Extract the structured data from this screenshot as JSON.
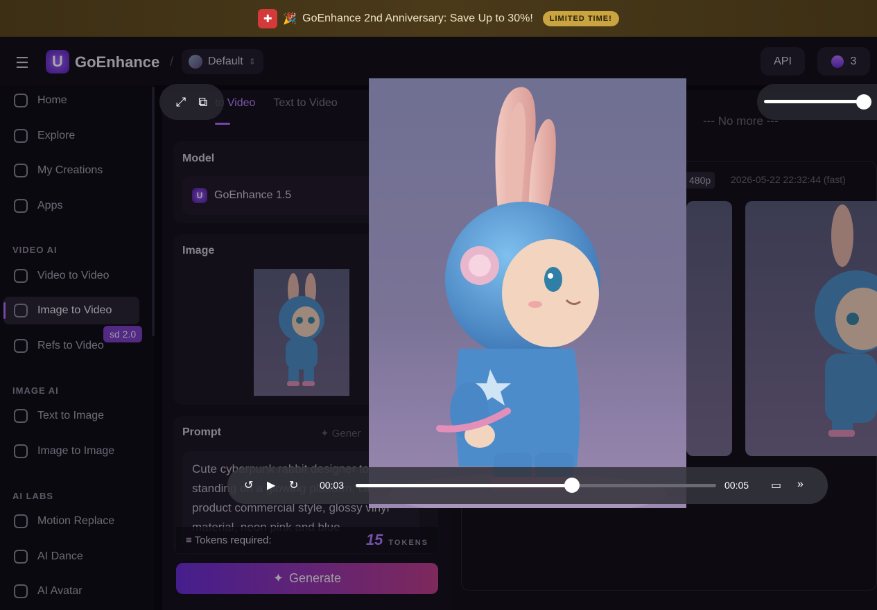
{
  "banner": {
    "party_emoji": "🎉",
    "text": "GoEnhance 2nd Anniversary: Save Up to 30%!",
    "badge": "LIMITED TIME!"
  },
  "header": {
    "brand": "GoEnhance",
    "workspace": "Default",
    "api_label": "API",
    "credits": "3"
  },
  "sidebar": {
    "items": [
      {
        "label": "Home"
      },
      {
        "label": "Explore"
      },
      {
        "label": "My Creations"
      },
      {
        "label": "Apps"
      }
    ],
    "section_video": "VIDEO AI",
    "video_items": [
      {
        "label": "Video to Video"
      },
      {
        "label": "Image to Video"
      },
      {
        "label": "Refs to Video"
      }
    ],
    "refs_badge": "sd 2.0",
    "section_image": "IMAGE AI",
    "image_items": [
      {
        "label": "Text to Image"
      },
      {
        "label": "Image to Image"
      }
    ],
    "section_labs": "AI LABS",
    "labs_items": [
      {
        "label": "Motion Replace"
      },
      {
        "label": "AI Dance"
      },
      {
        "label": "AI Avatar"
      }
    ]
  },
  "form": {
    "tabs": [
      {
        "label": "to Video"
      },
      {
        "label": "Text to Video"
      }
    ],
    "model_title": "Model",
    "model_value": "GoEnhance 1.5",
    "image_title": "Image",
    "prompt_title": "Prompt",
    "generate_hint": "Gener",
    "prompt_text": "Cute cyberpunk rabbit designer toy standing on a glowing platform, cinematic product commercial style, glossy vinyl material, neon pink and blue",
    "tokens_label": "Tokens required:",
    "tokens_value": "15",
    "tokens_unit": "TOKENS",
    "generate_label": "Generate"
  },
  "results": {
    "no_more": "--- No more ---",
    "resolution": "480p",
    "timestamp": "2026-05-22 22:32:44 (fast)"
  },
  "player": {
    "current_time": "00:03",
    "duration": "00:05",
    "progress": 0.6,
    "volume": 0.92
  }
}
